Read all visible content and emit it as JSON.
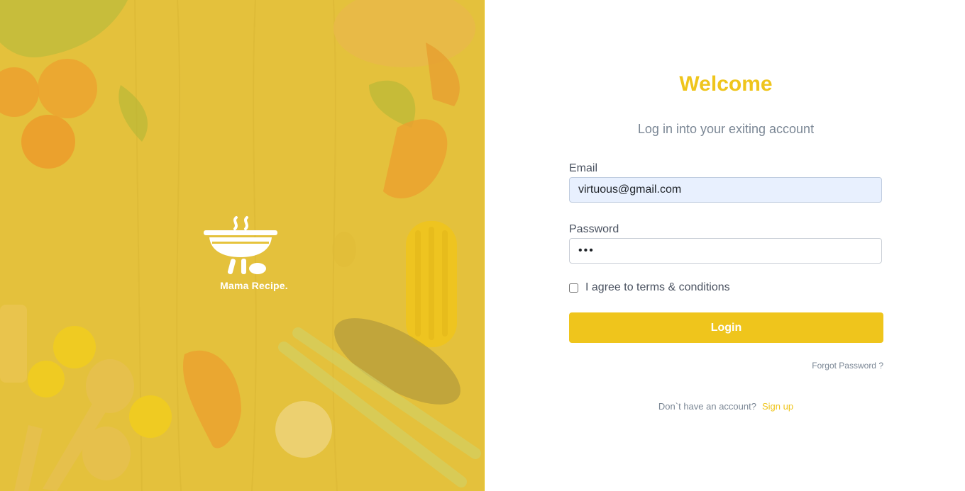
{
  "brand": {
    "name": "Mama Recipe.",
    "logo_icon": "grill-icon"
  },
  "login": {
    "title": "Welcome",
    "subtitle": "Log in into your exiting account",
    "email_label": "Email",
    "email_value": "virtuous@gmail.com",
    "password_label": "Password",
    "password_value": "•••",
    "agree_label": "I agree to terms & conditions",
    "agree_checked": false,
    "button_label": "Login",
    "forgot_label": "Forgot Password ?",
    "no_account_text": "Don`t have an account?",
    "signup_label": "Sign up"
  },
  "colors": {
    "accent": "#efc51c",
    "overlay": "#e6c33c",
    "muted_text": "#7b8795"
  }
}
